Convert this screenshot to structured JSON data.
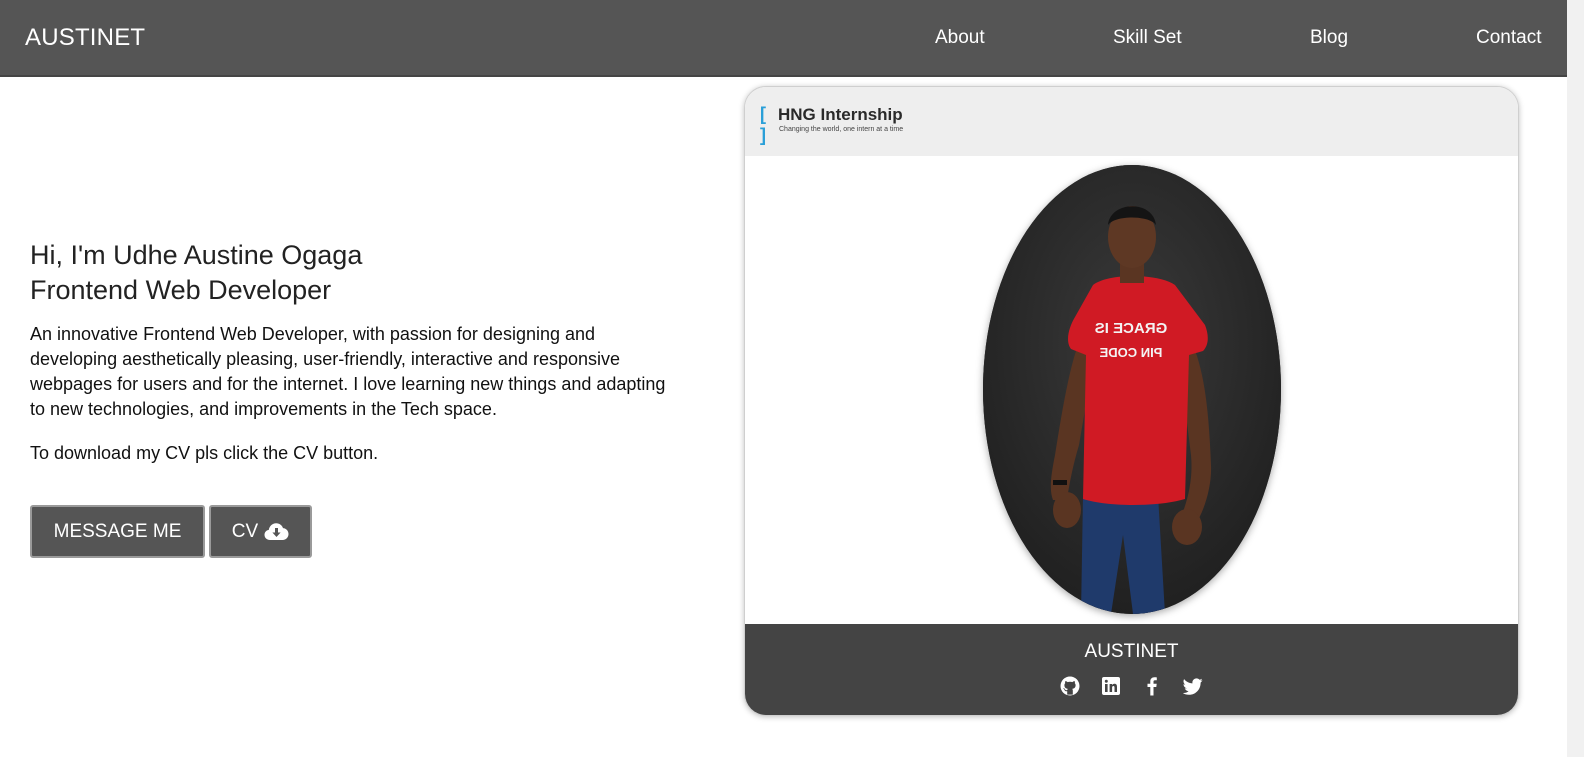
{
  "navbar": {
    "brand": "AUSTINET",
    "links": [
      {
        "label": "About"
      },
      {
        "label": "Skill Set"
      },
      {
        "label": "Blog"
      },
      {
        "label": "Contact"
      }
    ]
  },
  "intro": {
    "heading_line1": "Hi, I'm Udhe Austine Ogaga",
    "heading_line2": "Frontend Web Developer",
    "description": "An innovative Frontend Web Developer, with passion for designing and developing aesthetically pleasing, user-friendly, interactive and responsive webpages for users and for the internet. I love learning new things and adapting to new technologies, and improvements in the Tech space.",
    "cv_note": "To download my CV pls click the CV button.",
    "message_button": "MESSAGE ME",
    "cv_button": "CV",
    "cv_icon": "cloud-download-icon"
  },
  "card": {
    "logo_bracket": "[ ]",
    "logo_title": "HNG Internship",
    "logo_tagline": "Changing the world, one intern at a time",
    "photo_shirt_text_line1": "GRACE IS",
    "photo_shirt_text_line2": "PIN CODE",
    "footer_title": "AUSTINET",
    "socials": [
      "github-icon",
      "linkedin-icon",
      "facebook-icon",
      "twitter-icon"
    ]
  },
  "colors": {
    "navbar_bg": "#555555",
    "card_footer_bg": "#444444",
    "button_bg": "#555555",
    "logo_accent": "#2a9fd8"
  }
}
